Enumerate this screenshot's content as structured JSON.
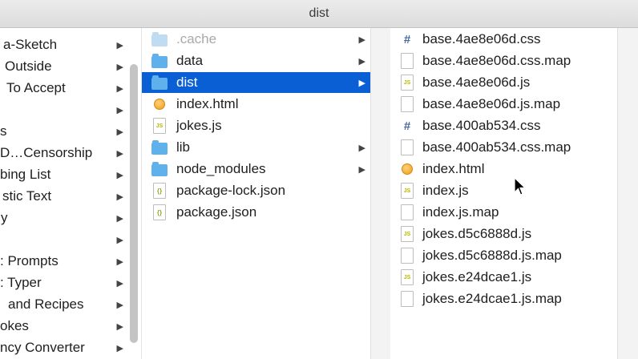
{
  "window": {
    "title": "dist"
  },
  "column1": {
    "items": [
      {
        "label": "a-Sketch",
        "has_children": true
      },
      {
        "label": "Outside",
        "has_children": true
      },
      {
        "label": "To Accept",
        "has_children": true
      },
      {
        "label": "",
        "has_children": true
      },
      {
        "label": "s",
        "has_children": true
      },
      {
        "label": "D…Censorship",
        "has_children": true
      },
      {
        "label": "bing List",
        "has_children": true
      },
      {
        "label": "stic Text",
        "has_children": true
      },
      {
        "label": "y",
        "has_children": true
      },
      {
        "label": "",
        "has_children": true
      },
      {
        "label": ": Prompts",
        "has_children": true
      },
      {
        "label": ": Typer",
        "has_children": true
      },
      {
        "label": "and Recipes",
        "has_children": true
      },
      {
        "label": "okes",
        "has_children": true
      },
      {
        "label": "ncy Converter",
        "has_children": true
      }
    ]
  },
  "column2": {
    "items": [
      {
        "name": ".cache",
        "icon": "folder-icon",
        "has_children": true,
        "dimmed": true
      },
      {
        "name": "data",
        "icon": "folder-icon",
        "has_children": true
      },
      {
        "name": "dist",
        "icon": "folder-icon",
        "has_children": true,
        "selected": true
      },
      {
        "name": "index.html",
        "icon": "html-file-icon",
        "has_children": false
      },
      {
        "name": "jokes.js",
        "icon": "js-file-icon",
        "has_children": false
      },
      {
        "name": "lib",
        "icon": "folder-icon",
        "has_children": true
      },
      {
        "name": "node_modules",
        "icon": "folder-icon",
        "has_children": true
      },
      {
        "name": "package-lock.json",
        "icon": "json-file-icon",
        "has_children": false
      },
      {
        "name": "package.json",
        "icon": "json-file-icon",
        "has_children": false
      }
    ]
  },
  "column3": {
    "items": [
      {
        "name": "base.4ae8e06d.css",
        "icon": "css-file-icon"
      },
      {
        "name": "base.4ae8e06d.css.map",
        "icon": "file-icon"
      },
      {
        "name": "base.4ae8e06d.js",
        "icon": "js-file-icon"
      },
      {
        "name": "base.4ae8e06d.js.map",
        "icon": "file-icon"
      },
      {
        "name": "base.400ab534.css",
        "icon": "css-file-icon"
      },
      {
        "name": "base.400ab534.css.map",
        "icon": "file-icon"
      },
      {
        "name": "index.html",
        "icon": "html-file-icon"
      },
      {
        "name": "index.js",
        "icon": "js-file-icon"
      },
      {
        "name": "index.js.map",
        "icon": "file-icon"
      },
      {
        "name": "jokes.d5c6888d.js",
        "icon": "js-file-icon"
      },
      {
        "name": "jokes.d5c6888d.js.map",
        "icon": "file-icon"
      },
      {
        "name": "jokes.e24dcae1.js",
        "icon": "js-file-icon"
      },
      {
        "name": "jokes.e24dcae1.js.map",
        "icon": "file-icon"
      }
    ]
  },
  "icons": {
    "expand_arrow": "▶",
    "js_glyph": "JS",
    "json_glyph": "{}",
    "css_glyph": "#"
  },
  "colors": {
    "selection": "#0b5fd5",
    "folder": "#5fb1ec"
  }
}
